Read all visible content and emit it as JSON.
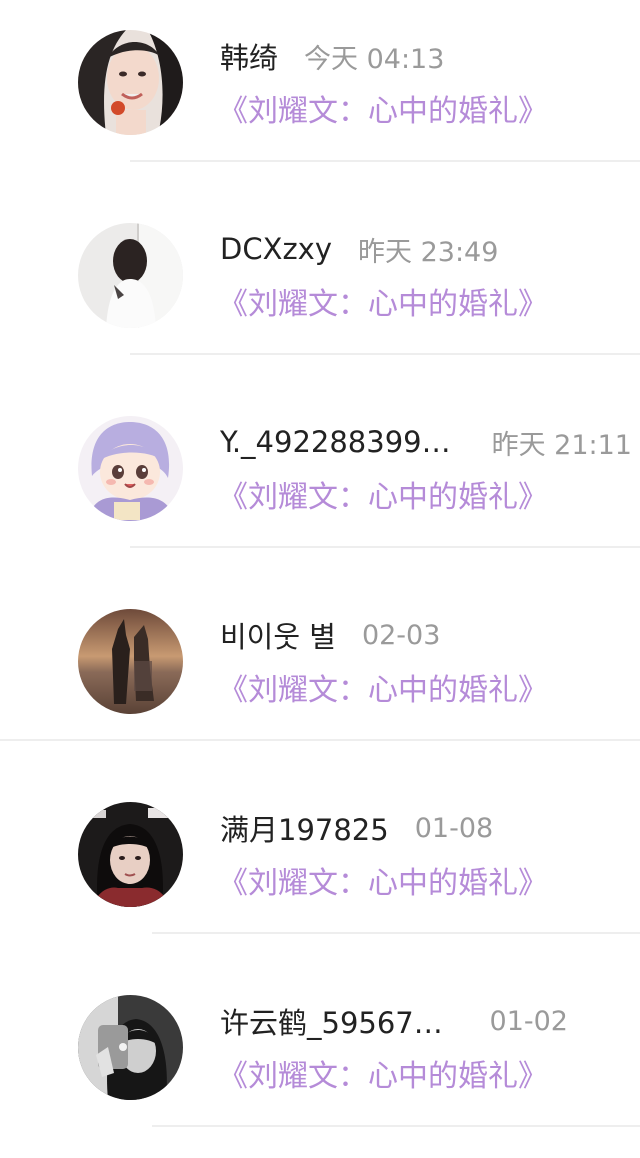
{
  "comments": [
    {
      "user": "韩绮",
      "time": "今天 04:13",
      "book": "《刘耀文：心中的婚礼》",
      "avatar": "avatar-girl-smiling"
    },
    {
      "user": "DCXzxy",
      "time": "昨天 23:49",
      "book": "《刘耀文：心中的婚礼》",
      "avatar": "avatar-girl-back"
    },
    {
      "user": "Y._492288399…",
      "time": "昨天 21:11",
      "book": "《刘耀文：心中的婚礼》",
      "avatar": "avatar-anime-girl"
    },
    {
      "user": "비이웃 별",
      "time": "02-03",
      "book": "《刘耀文：心中的婚礼》",
      "avatar": "avatar-couple-sunset"
    },
    {
      "user": "满月197825",
      "time": "01-08",
      "book": "《刘耀文：心中的婚礼》",
      "avatar": "avatar-girl-portrait"
    },
    {
      "user": "许云鹤_59567…",
      "time": "01-02",
      "book": "《刘耀文：心中的婚礼》",
      "avatar": "avatar-girl-bw"
    }
  ],
  "colors": {
    "name": "#222222",
    "time": "#9a9a9a",
    "book_title": "#b58bd8",
    "divider": "#eeeeee"
  }
}
